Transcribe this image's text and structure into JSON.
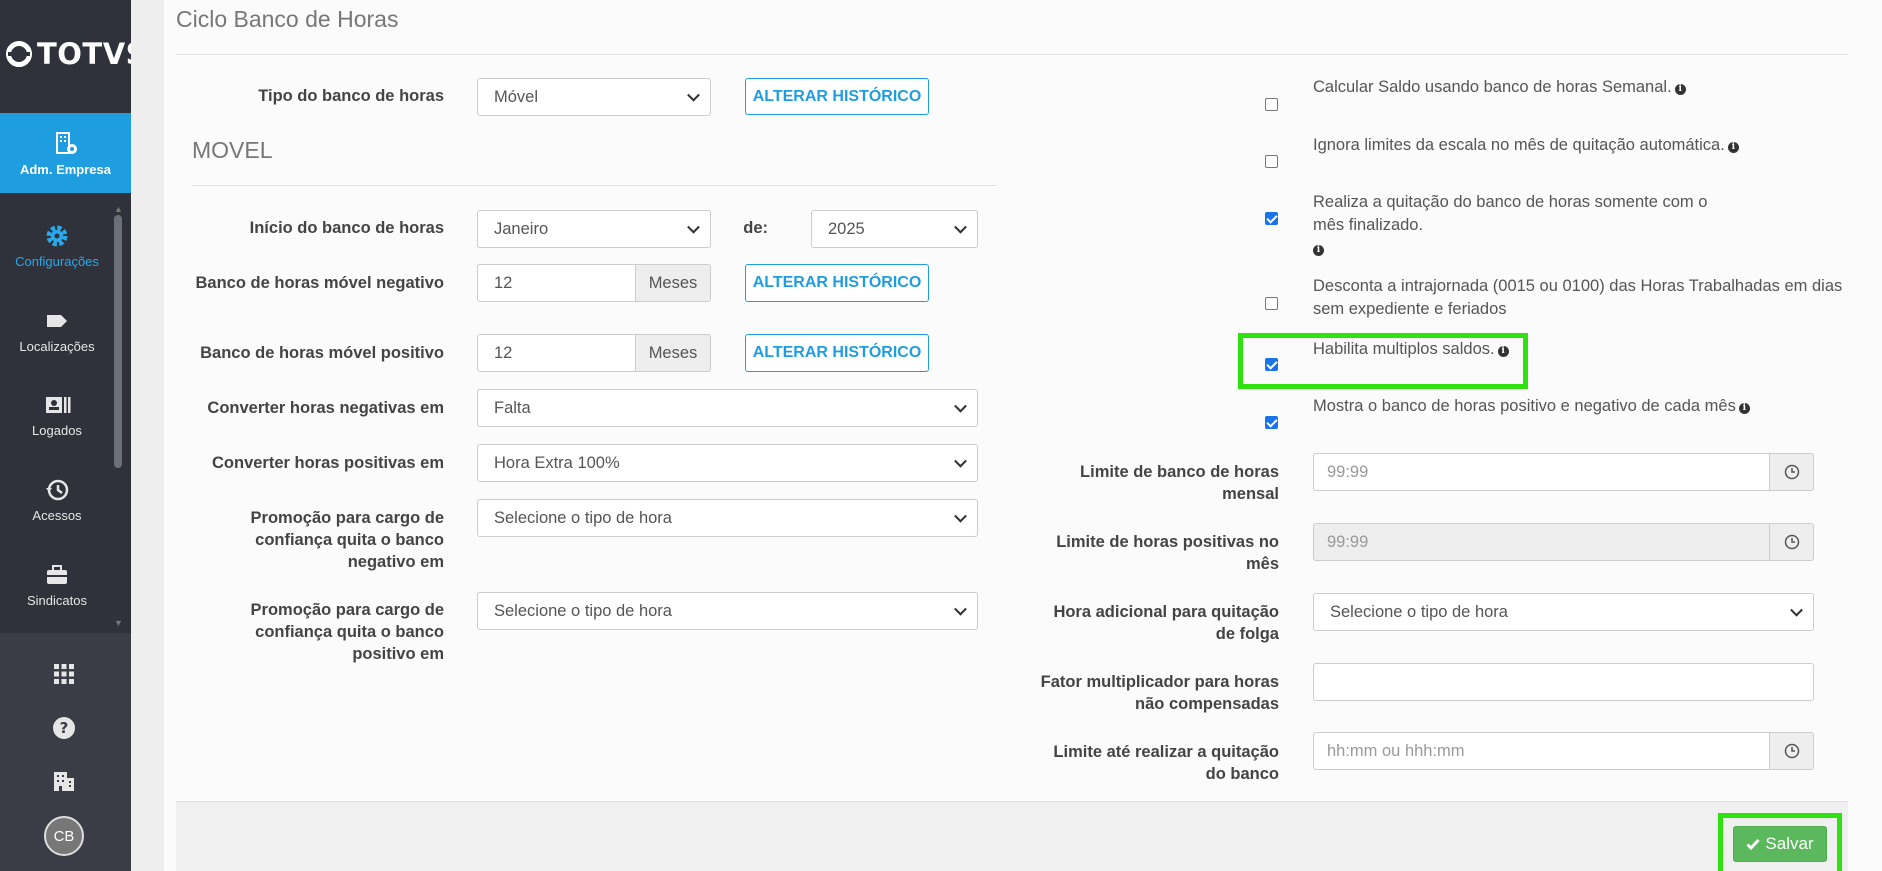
{
  "brand": {
    "name": "TOTVS"
  },
  "sidebar": {
    "active": {
      "label": "Adm. Empresa",
      "icon": "building-gear-icon"
    },
    "items": [
      {
        "label": "Configurações",
        "icon": "gear-icon"
      },
      {
        "label": "Localizações",
        "icon": "tag-icon"
      },
      {
        "label": "Logados",
        "icon": "id-card-icon"
      },
      {
        "label": "Acessos",
        "icon": "history-icon"
      },
      {
        "label": "Sindicatos",
        "icon": "briefcase-icon"
      }
    ],
    "bottom": [
      {
        "icon": "grid-icon"
      },
      {
        "icon": "help-icon"
      },
      {
        "icon": "building-icon"
      }
    ],
    "avatar": "CB"
  },
  "page": {
    "title": "Ciclo Banco de Horas",
    "section_title": "MOVEL"
  },
  "left": {
    "tipo": {
      "label": "Tipo do banco de horas",
      "value": "Móvel",
      "button": "ALTERAR HISTÓRICO"
    },
    "inicio": {
      "label": "Início do banco de horas",
      "value": "Janeiro",
      "de_label": "de:",
      "year": "2025"
    },
    "negativo": {
      "label": "Banco de horas móvel negativo",
      "value": "12",
      "addon": "Meses",
      "button": "ALTERAR HISTÓRICO"
    },
    "positivo": {
      "label": "Banco de horas móvel positivo",
      "value": "12",
      "addon": "Meses",
      "button": "ALTERAR HISTÓRICO"
    },
    "conv_neg": {
      "label": "Converter horas negativas em",
      "value": "Falta"
    },
    "conv_pos": {
      "label": "Converter horas positivas em",
      "value": "Hora Extra 100%"
    },
    "promo_neg": {
      "label": "Promoção para cargo de confiança quita o banco negativo em",
      "value": "Selecione o tipo de hora"
    },
    "promo_pos": {
      "label": "Promoção para cargo de confiança quita o banco positivo em",
      "value": "Selecione o tipo de hora"
    }
  },
  "right": {
    "checks": [
      {
        "label": "Calcular Saldo usando banco de horas Semanal.",
        "checked": false
      },
      {
        "label": "Ignora limites da escala no mês de quitação automática.",
        "checked": false
      },
      {
        "label": "Realiza a quitação do banco de horas somente com o mês finalizado.",
        "checked": true
      },
      {
        "label": "Desconta a intrajornada (0015 ou 0100) das Horas Trabalhadas em dias sem expediente e feriados",
        "checked": false
      },
      {
        "label": "Habilita multiplos saldos.",
        "checked": true
      },
      {
        "label": "Mostra o banco de horas positivo e negativo de cada mês",
        "checked": true
      }
    ],
    "limite_mensal": {
      "label": "Limite de banco de horas mensal",
      "placeholder": "99:99"
    },
    "limite_pos": {
      "label": "Limite de horas positivas no mês",
      "placeholder": "99:99"
    },
    "hora_adicional": {
      "label": "Hora adicional para quitação de folga",
      "value": "Selecione o tipo de hora"
    },
    "fator": {
      "label": "Fator multiplicador para horas não compensadas",
      "value": ""
    },
    "limite_quitacao": {
      "label": "Limite até realizar a quitação do banco",
      "placeholder": "hh:mm ou hhh:mm"
    }
  },
  "footer": {
    "save_label": "Salvar"
  },
  "colors": {
    "accent": "#1e9ee1",
    "sidebar": "#2f323a",
    "save": "#5cb85c",
    "highlight": "#2fe20f"
  }
}
